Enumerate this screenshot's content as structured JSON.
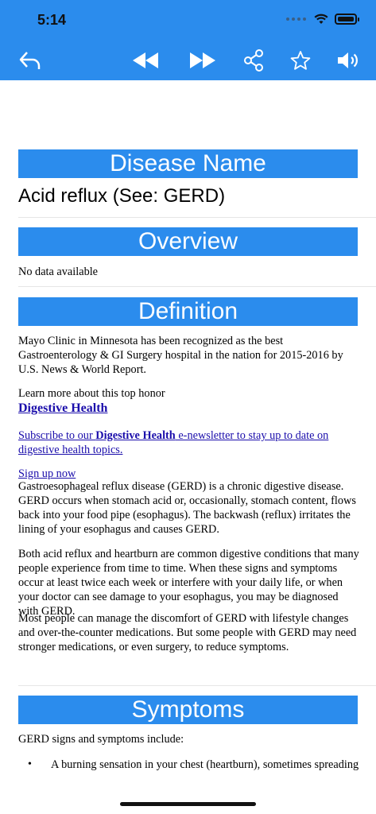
{
  "status_bar": {
    "time": "5:14"
  },
  "toolbar": {
    "back_icon": "back-arrow-icon",
    "rewind_icon": "rewind-icon",
    "forward_icon": "fast-forward-icon",
    "share_icon": "share-icon",
    "star_icon": "star-icon",
    "volume_icon": "volume-icon"
  },
  "sections": {
    "disease_name": {
      "header": "Disease Name",
      "value": "Acid reflux (See: GERD)"
    },
    "overview": {
      "header": "Overview",
      "text": "No data available"
    },
    "definition": {
      "header": "Definition",
      "p1": "Mayo Clinic in Minnesota has been recognized as the best Gastroenterology & GI Surgery hospital in the nation for 2015-2016 by U.S. News & World Report.",
      "p2": "Learn more about this top honor",
      "link_digestive": "Digestive Health",
      "subscribe_pre": "Subscribe to our ",
      "subscribe_bold": "Digestive Health",
      "subscribe_post": " e-newsletter to stay up to date on digestive health topics.",
      "signup": "Sign up now",
      "p3": "Gastroesophageal reflux disease (GERD) is a chronic digestive disease. GERD occurs when stomach acid or, occasionally, stomach content, flows back into your food pipe (esophagus). The backwash (reflux) irritates the lining of your esophagus and causes GERD.",
      "p4": "Both acid reflux and heartburn are common digestive conditions that many people experience from time to time. When these signs and symptoms occur at least twice each week or interfere with your daily life, or when your doctor can see damage to your esophagus, you may be diagnosed with GERD.",
      "p5": "Most people can manage the discomfort of GERD with lifestyle changes and over-the-counter medications. But some people with GERD may need stronger medications, or even surgery, to reduce symptoms."
    },
    "symptoms": {
      "header": "Symptoms",
      "intro": "GERD signs and symptoms include:",
      "bullet1": "A burning sensation in your chest (heartburn), sometimes spreading to"
    }
  },
  "colors": {
    "accent": "#2b8ced",
    "link": "#1a0dab"
  }
}
